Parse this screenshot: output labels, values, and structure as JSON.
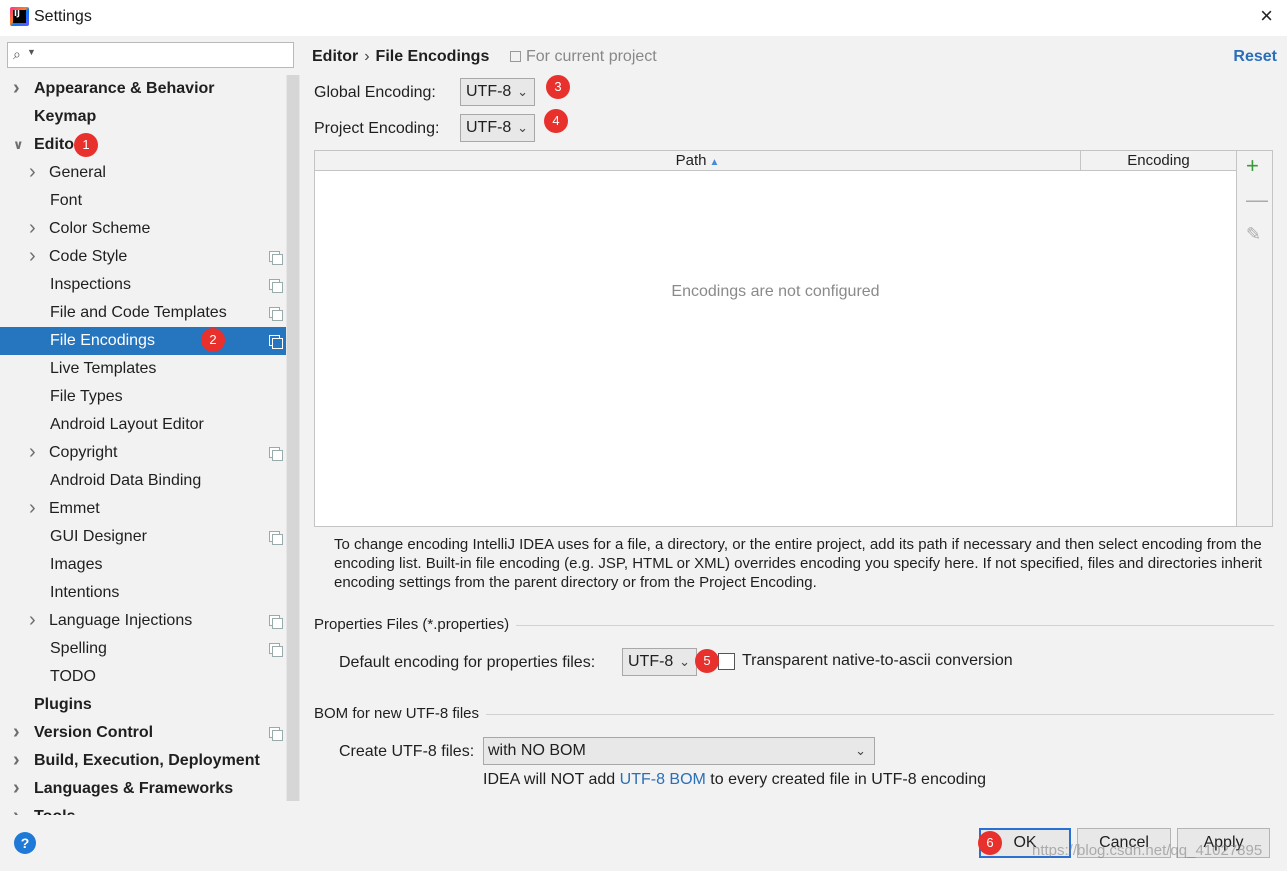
{
  "window": {
    "title": "Settings",
    "close_icon": "×"
  },
  "sidebar": {
    "search_placeholder": "",
    "items": [
      {
        "label": "Appearance & Behavior",
        "level": 0,
        "bold": true,
        "expandable": true,
        "expanded": false,
        "project_icon": false
      },
      {
        "label": "Keymap",
        "level": 0,
        "bold": true,
        "expandable": false,
        "project_icon": false
      },
      {
        "label": "Editor",
        "level": 0,
        "bold": true,
        "expandable": true,
        "expanded": true,
        "project_icon": false
      },
      {
        "label": "General",
        "level": 1,
        "expandable": true,
        "expanded": false,
        "project_icon": false
      },
      {
        "label": "Font",
        "level": 1,
        "expandable": false,
        "project_icon": false
      },
      {
        "label": "Color Scheme",
        "level": 1,
        "expandable": true,
        "expanded": false,
        "project_icon": false
      },
      {
        "label": "Code Style",
        "level": 1,
        "expandable": true,
        "expanded": false,
        "project_icon": true
      },
      {
        "label": "Inspections",
        "level": 1,
        "expandable": false,
        "project_icon": true
      },
      {
        "label": "File and Code Templates",
        "level": 1,
        "expandable": false,
        "project_icon": true
      },
      {
        "label": "File Encodings",
        "level": 1,
        "expandable": false,
        "project_icon": true,
        "selected": true
      },
      {
        "label": "Live Templates",
        "level": 1,
        "expandable": false,
        "project_icon": false
      },
      {
        "label": "File Types",
        "level": 1,
        "expandable": false,
        "project_icon": false
      },
      {
        "label": "Android Layout Editor",
        "level": 1,
        "expandable": false,
        "project_icon": false
      },
      {
        "label": "Copyright",
        "level": 1,
        "expandable": true,
        "expanded": false,
        "project_icon": true
      },
      {
        "label": "Android Data Binding",
        "level": 1,
        "expandable": false,
        "project_icon": false
      },
      {
        "label": "Emmet",
        "level": 1,
        "expandable": true,
        "expanded": false,
        "project_icon": false
      },
      {
        "label": "GUI Designer",
        "level": 1,
        "expandable": false,
        "project_icon": true
      },
      {
        "label": "Images",
        "level": 1,
        "expandable": false,
        "project_icon": false
      },
      {
        "label": "Intentions",
        "level": 1,
        "expandable": false,
        "project_icon": false
      },
      {
        "label": "Language Injections",
        "level": 1,
        "expandable": true,
        "expanded": false,
        "project_icon": true
      },
      {
        "label": "Spelling",
        "level": 1,
        "expandable": false,
        "project_icon": true
      },
      {
        "label": "TODO",
        "level": 1,
        "expandable": false,
        "project_icon": false
      },
      {
        "label": "Plugins",
        "level": 0,
        "bold": true,
        "expandable": false,
        "project_icon": false
      },
      {
        "label": "Version Control",
        "level": 0,
        "bold": true,
        "expandable": true,
        "expanded": false,
        "project_icon": true
      },
      {
        "label": "Build, Execution, Deployment",
        "level": 0,
        "bold": true,
        "expandable": true,
        "expanded": false,
        "project_icon": false
      },
      {
        "label": "Languages & Frameworks",
        "level": 0,
        "bold": true,
        "expandable": true,
        "expanded": false,
        "project_icon": false
      },
      {
        "label": "Tools",
        "level": 0,
        "bold": true,
        "expandable": true,
        "expanded": false,
        "project_icon": false
      }
    ]
  },
  "annotations": {
    "b1": "1",
    "b2": "2",
    "b3": "3",
    "b4": "4",
    "b5": "5",
    "b6": "6"
  },
  "main": {
    "breadcrumb_parent": "Editor",
    "breadcrumb_sep": "›",
    "breadcrumb_current": "File Encodings",
    "scope_note": "For current project",
    "reset_label": "Reset",
    "global_encoding_label": "Global Encoding:",
    "global_encoding_value": "UTF-8",
    "project_encoding_label": "Project Encoding:",
    "project_encoding_value": "UTF-8",
    "table": {
      "col_path": "Path",
      "col_encoding": "Encoding",
      "sort_indicator": "▲",
      "empty_message": "Encodings are not configured",
      "add_icon": "+",
      "remove_icon": "—",
      "edit_icon": "✎"
    },
    "help_text": "To change encoding IntelliJ IDEA uses for a file, a directory, or the entire project, add its path if necessary and then select encoding from the encoding list. Built-in file encoding (e.g. JSP, HTML or XML) overrides encoding you specify here. If not specified, files and directories inherit encoding settings from the parent directory or from the Project Encoding.",
    "properties_section": "Properties Files (*.properties)",
    "properties_label": "Default encoding for properties files:",
    "properties_value": "UTF-8",
    "native_ascii_label": "Transparent native-to-ascii conversion",
    "native_ascii_checked": false,
    "bom_section": "BOM for new UTF-8 files",
    "bom_label": "Create UTF-8 files:",
    "bom_value": "with NO BOM",
    "bom_note_pre": "IDEA will NOT add ",
    "bom_note_link": "UTF-8 BOM",
    "bom_note_post": " to every created file in UTF-8 encoding"
  },
  "footer": {
    "help_label": "?",
    "ok_label": "OK",
    "cancel_label": "Cancel",
    "apply_label": "Apply",
    "watermark": "https://blog.csdn.net/qq_41027895"
  },
  "colors": {
    "accent": "#2675bf",
    "link": "#2a6fb8",
    "badge": "#e8302c",
    "add": "#3a9a3a"
  }
}
